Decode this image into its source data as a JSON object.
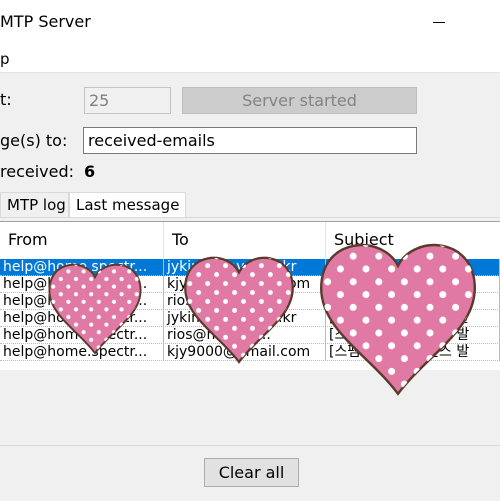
{
  "window": {
    "title": "MTP Server",
    "minimize_icon": "minimize-icon"
  },
  "menu": {
    "item_help": "p"
  },
  "form": {
    "port_label": "t:",
    "port_value": "25",
    "server_button": "Server started",
    "save_label": "ge(s) to:",
    "save_value": "received-emails",
    "received_label": "received:",
    "received_count": "6"
  },
  "tabs": [
    {
      "label": "MTP log"
    },
    {
      "label": "Last message"
    }
  ],
  "table": {
    "columns": [
      "From",
      "To",
      "Subject"
    ],
    "rows": [
      {
        "from": "help@home.spectr...",
        "to": "jykim@naver.co.kr",
        "subject": "[스팸 차단] 라이선스 발"
      },
      {
        "from": "help@home.spectr...",
        "to": "kjy9000@gmail.com",
        "subject": "[스팸 차단] 라이선스 발"
      },
      {
        "from": "help@home.spectr...",
        "to": "rios@naver.com",
        "subject": "[스팸 차단] 라이선스 발"
      },
      {
        "from": "help@home.spectr...",
        "to": "jykim@naver.co.kr",
        "subject": "[스팸 차단] 라이선스 발"
      },
      {
        "from": "help@home.spectr...",
        "to": "rios@naver.c...",
        "subject": "[스팸 차단] 라이선스 발"
      },
      {
        "from": "help@home.spectr...",
        "to": "kjy9000@gmail.com",
        "subject": "[스팸 차단] 라이선스 발"
      }
    ]
  },
  "footer": {
    "clear_button": "Clear all"
  },
  "colors": {
    "selection": "#0078d7",
    "heart_fill": "#e07aa4",
    "heart_stroke": "#5a3a2a"
  }
}
